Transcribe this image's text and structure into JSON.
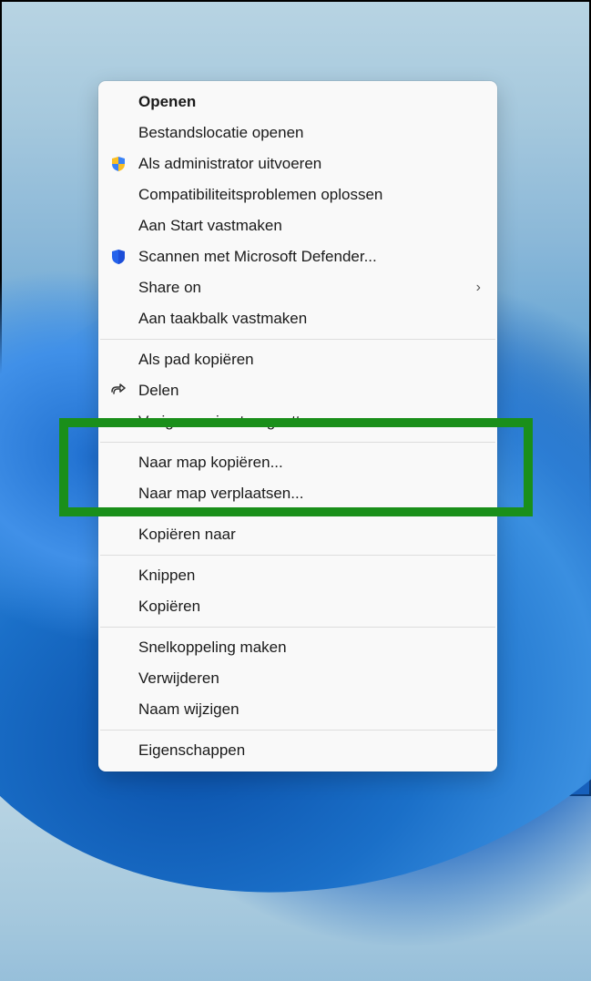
{
  "context_menu": {
    "groups": [
      {
        "items": [
          {
            "key": "open",
            "label": "Openen",
            "bold": true
          },
          {
            "key": "open-file-location",
            "label": "Bestandslocatie openen"
          },
          {
            "key": "run-as-admin",
            "label": "Als administrator uitvoeren",
            "icon": "shield-uac"
          },
          {
            "key": "troubleshoot-compat",
            "label": "Compatibiliteitsproblemen oplossen"
          },
          {
            "key": "pin-start",
            "label": "Aan Start vastmaken"
          },
          {
            "key": "scan-defender",
            "label": "Scannen met Microsoft Defender...",
            "icon": "shield-defender"
          },
          {
            "key": "share-on",
            "label": "Share on",
            "submenu": true
          },
          {
            "key": "pin-taskbar",
            "label": "Aan taakbalk vastmaken"
          }
        ]
      },
      {
        "items": [
          {
            "key": "copy-as-path",
            "label": "Als pad kopiëren"
          },
          {
            "key": "share",
            "label": "Delen",
            "icon": "share"
          },
          {
            "key": "restore-versions",
            "label": "Vorige versies terugzetten"
          }
        ]
      },
      {
        "items": [
          {
            "key": "copy-to-folder",
            "label": "Naar map kopiëren..."
          },
          {
            "key": "move-to-folder",
            "label": "Naar map verplaatsen..."
          }
        ]
      },
      {
        "items": [
          {
            "key": "copy-to",
            "label": "Kopiëren naar"
          }
        ]
      },
      {
        "items": [
          {
            "key": "cut",
            "label": "Knippen"
          },
          {
            "key": "copy",
            "label": "Kopiëren"
          }
        ]
      },
      {
        "items": [
          {
            "key": "create-shortcut",
            "label": "Snelkoppeling maken"
          },
          {
            "key": "delete",
            "label": "Verwijderen"
          },
          {
            "key": "rename",
            "label": "Naam wijzigen"
          }
        ]
      },
      {
        "items": [
          {
            "key": "properties",
            "label": "Eigenschappen"
          }
        ]
      }
    ]
  },
  "highlight": {
    "color": "#1a8f1a"
  }
}
